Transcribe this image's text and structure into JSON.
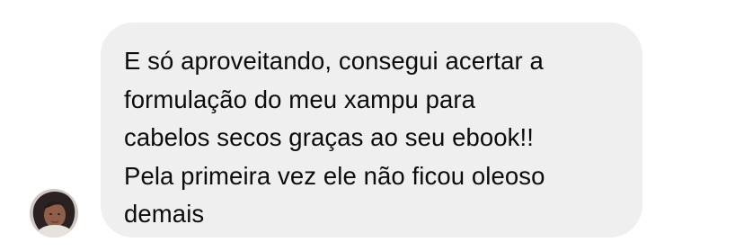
{
  "conversation": {
    "incoming_message": {
      "sender_avatar": "profile-photo",
      "text": "E só aproveitando, consegui acertar a\nformulação do meu xampu para\ncabelos secos graças ao seu ebook!!\nPela primeira vez ele não ficou oleoso\ndemais"
    }
  },
  "colors": {
    "bubble_background": "#efefef",
    "text": "#0c0c0c",
    "page_background": "#ffffff"
  }
}
